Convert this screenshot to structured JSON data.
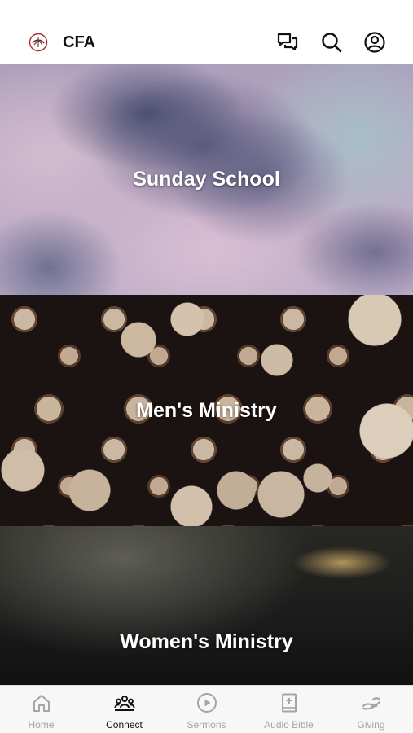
{
  "header": {
    "app_title": "CFA",
    "icons": [
      "logo-icon",
      "chat-icon",
      "search-icon",
      "profile-icon"
    ]
  },
  "cards": [
    {
      "title": "Sunday School"
    },
    {
      "title": "Men's Ministry"
    },
    {
      "title": "Women's Ministry"
    }
  ],
  "tabbar": {
    "active": "Connect",
    "tabs": [
      {
        "label": "Home",
        "icon": "home-icon"
      },
      {
        "label": "Connect",
        "icon": "people-icon"
      },
      {
        "label": "Sermons",
        "icon": "play-circle-icon"
      },
      {
        "label": "Audio Bible",
        "icon": "book-icon"
      },
      {
        "label": "Giving",
        "icon": "giving-hand-icon"
      }
    ]
  },
  "colors": {
    "active_tab": "#111111",
    "inactive_tab": "#a5a5a5",
    "header_bg": "#ffffff",
    "tabbar_bg": "#f7f7f7",
    "logo_accent": "#b3262e"
  }
}
